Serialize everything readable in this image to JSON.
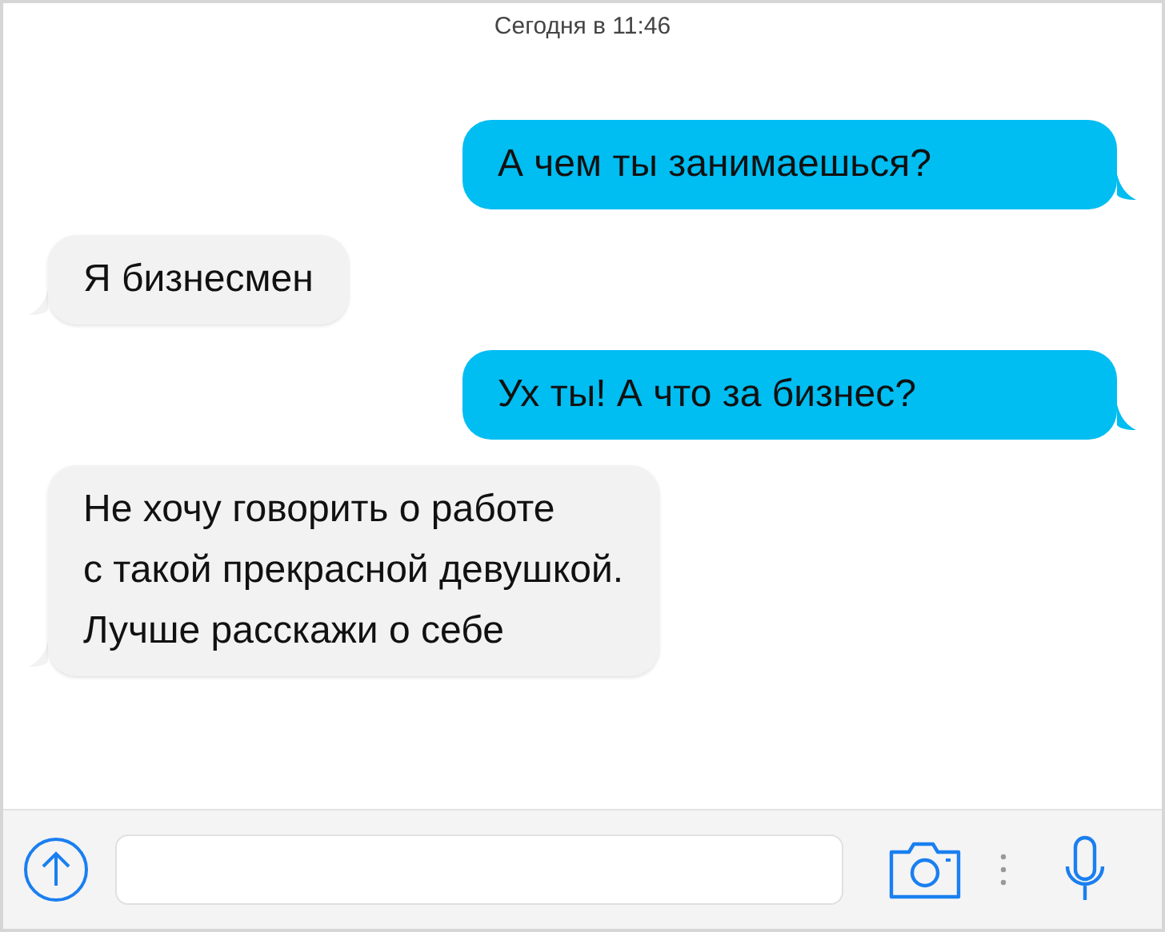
{
  "timestamp": "Сегодня в 11:46",
  "messages": [
    {
      "kind": "sent",
      "text": "А чем ты занимаешься?"
    },
    {
      "kind": "received",
      "text": "Я бизнесмен"
    },
    {
      "kind": "sent",
      "text": "Ух ты! А что за бизнес?"
    },
    {
      "kind": "received",
      "text": "Не хочу говорить о работе\nс такой прекрасной девушкой.\nЛучше расскажи о себе"
    }
  ]
}
